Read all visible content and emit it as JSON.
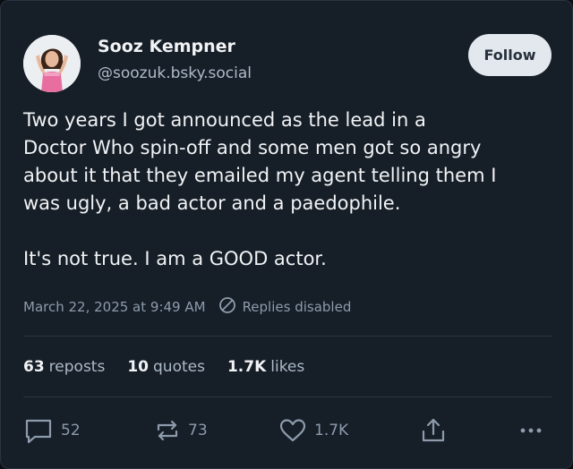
{
  "author": {
    "name": "Sooz Kempner",
    "handle": "@soozuk.bsky.social"
  },
  "follow_label": "Follow",
  "post": {
    "paragraph1_lines": [
      "Two years I got announced as the lead in a",
      "Doctor Who spin-off and some men got so angry",
      "about it that they emailed my agent telling them I",
      "was ugly, a bad actor and a paedophile."
    ],
    "paragraph2": "It's not true. I am a GOOD actor."
  },
  "meta": {
    "timestamp": "March 22, 2025 at 9:49 AM",
    "replies_status": "Replies disabled"
  },
  "stats": {
    "reposts_count": "63",
    "reposts_label": "reposts",
    "quotes_count": "10",
    "quotes_label": "quotes",
    "likes_count": "1.7K",
    "likes_label": "likes"
  },
  "actions": {
    "reply_count": "52",
    "repost_count": "73",
    "like_count": "1.7K"
  },
  "icons": {
    "replies_disabled": "circle-slash-icon",
    "reply": "speech-bubble-icon",
    "repost": "repost-arrows-icon",
    "like": "heart-icon",
    "share": "share-icon",
    "more": "more-dots-icon"
  },
  "colors": {
    "background": "#161e27",
    "text_primary": "#f1f3f5",
    "text_secondary": "#aebbc9",
    "text_muted": "#8d9bac",
    "follow_button_bg": "#e3e8ee"
  }
}
